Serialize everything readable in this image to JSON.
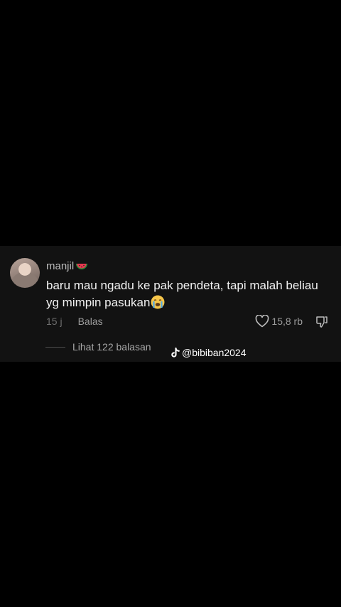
{
  "comment": {
    "username": "manjil",
    "username_emoji_icon": "watermelon-icon",
    "text": "baru mau ngadu ke pak pendeta, tapi malah beliau yg mimpin pasukan",
    "text_emoji_icon": "crying-face-icon",
    "time": "15 j",
    "reply_label": "Balas",
    "like_count": "15,8 rb",
    "view_replies_label": "Lihat 122 balasan"
  },
  "watermark": {
    "icon": "tiktok-icon",
    "handle": "@bibiban2024"
  },
  "colors": {
    "background": "#000000",
    "card": "#121212",
    "text": "#f2f2f2",
    "muted": "#9c9c9c"
  }
}
